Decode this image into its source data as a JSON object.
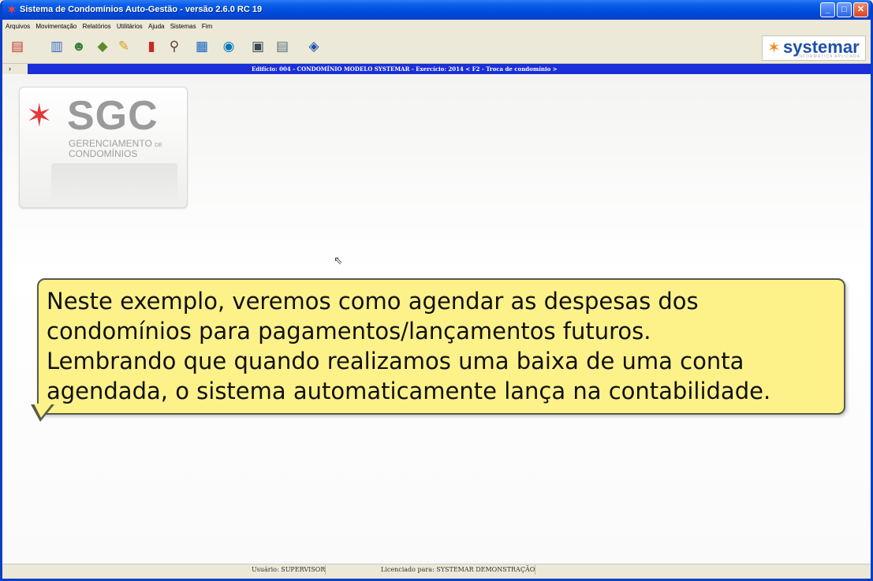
{
  "window": {
    "title": "Sistema de Condomínios Auto-Gestão - versão 2.6.0 RC 19",
    "controls": {
      "minimize": "_",
      "maximize": "□",
      "close": "✕"
    }
  },
  "menu": {
    "items": [
      "Arquivos",
      "Movimentação",
      "Relatórios",
      "Utilitários",
      "Ajuda",
      "Sistemas",
      "Fim"
    ]
  },
  "toolbar": {
    "icons": [
      {
        "name": "exit-door-icon",
        "glyph": "▤",
        "color": "#c0392b"
      },
      {
        "name": "building-icon",
        "glyph": "▥",
        "color": "#3a6fc4"
      },
      {
        "name": "people-icon",
        "glyph": "☻",
        "color": "#2e7d32"
      },
      {
        "name": "money-icon",
        "glyph": "◆",
        "color": "#5e8b2a"
      },
      {
        "name": "edit-document-icon",
        "glyph": "✎",
        "color": "#d4a017"
      },
      {
        "name": "bar-chart-icon",
        "glyph": "▮",
        "color": "#c62828"
      },
      {
        "name": "stamp-icon",
        "glyph": "⚲",
        "color": "#5d4037"
      },
      {
        "name": "calendar-icon",
        "glyph": "▦",
        "color": "#1565c0"
      },
      {
        "name": "globe-icon",
        "glyph": "◉",
        "color": "#0277bd"
      },
      {
        "name": "monitor-icon",
        "glyph": "▣",
        "color": "#37474f"
      },
      {
        "name": "calculator-icon",
        "glyph": "▤",
        "color": "#546e7a"
      },
      {
        "name": "help-icon",
        "glyph": "◈",
        "color": "#1e4fa8"
      }
    ],
    "brand": {
      "mark": "✶",
      "name": "systemar",
      "sub": "INFORMÁTICA APLICADA"
    }
  },
  "infobar": {
    "chevron": "›",
    "text": "Edifício: 004 - CONDOMÍNIO MODELO SYSTEMAR - Exercício: 2014   < F2 - Troca de condomínio >"
  },
  "logo": {
    "mark": "✶",
    "title": "SGC",
    "line1": "GERENCIAMENTO",
    "line1_suffix": "DE",
    "line2": "CONDOMÍNIOS"
  },
  "callout": {
    "lines": [
      "Neste exemplo, veremos como agendar as despesas dos",
      "condomínios para pagamentos/lançamentos futuros.",
      "Lembrando que quando realizamos uma baixa de uma conta",
      "agendada, o sistema automaticamente lança na contabilidade."
    ]
  },
  "status": {
    "user": "Usuário: SUPERVISOR",
    "license": "Licenciado para: SYSTEMAR DEMONSTRAÇÃO"
  }
}
